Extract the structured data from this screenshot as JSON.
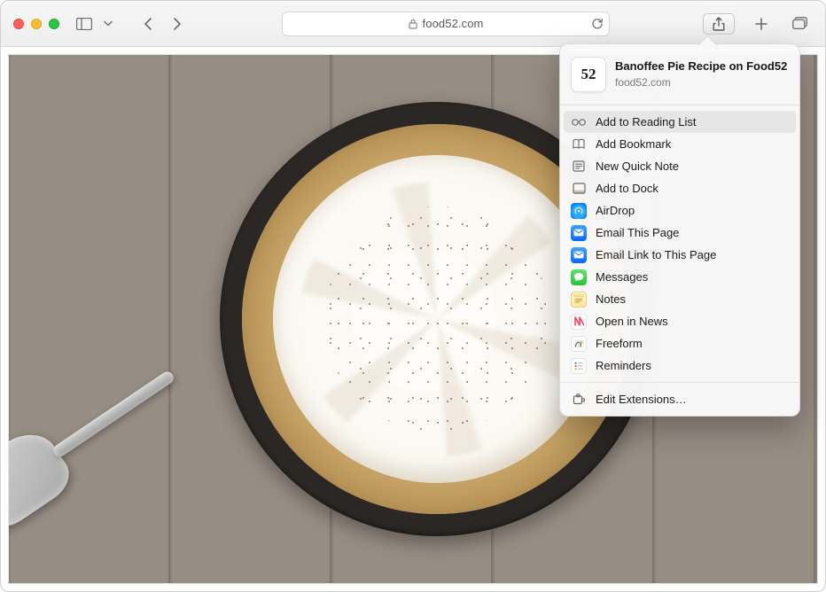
{
  "address": {
    "host": "food52.com"
  },
  "share": {
    "favicon_text": "52",
    "title": "Banoffee Pie Recipe on Food52",
    "domain": "food52.com",
    "items": [
      {
        "label": "Add to Reading List",
        "highlight": true
      },
      {
        "label": "Add Bookmark"
      },
      {
        "label": "New Quick Note"
      },
      {
        "label": "Add to Dock"
      },
      {
        "label": "AirDrop"
      },
      {
        "label": "Email This Page"
      },
      {
        "label": "Email Link to This Page"
      },
      {
        "label": "Messages"
      },
      {
        "label": "Notes"
      },
      {
        "label": "Open in News"
      },
      {
        "label": "Freeform"
      },
      {
        "label": "Reminders"
      }
    ],
    "footer": {
      "label": "Edit Extensions…"
    }
  }
}
